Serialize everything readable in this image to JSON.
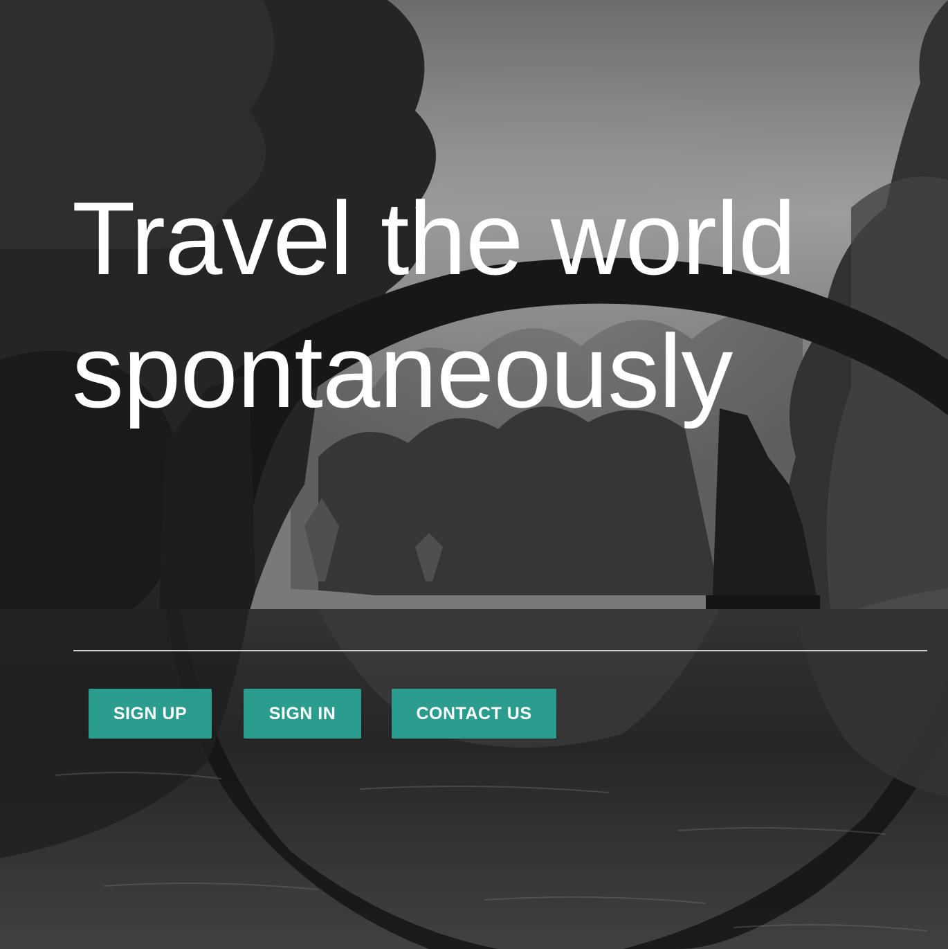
{
  "hero": {
    "headline_line1": "Travel the world",
    "headline_line2": "spontaneously",
    "background_image": "black-and-white photo of stone arch bridge reflected in forest lake"
  },
  "actions": {
    "sign_up_label": "SIGN UP",
    "sign_in_label": "SIGN IN",
    "contact_label": "CONTACT US"
  },
  "colors": {
    "button_bg": "#2a9d8f",
    "button_text": "#ffffff",
    "headline": "#ffffff",
    "divider": "#cfcfcf"
  }
}
